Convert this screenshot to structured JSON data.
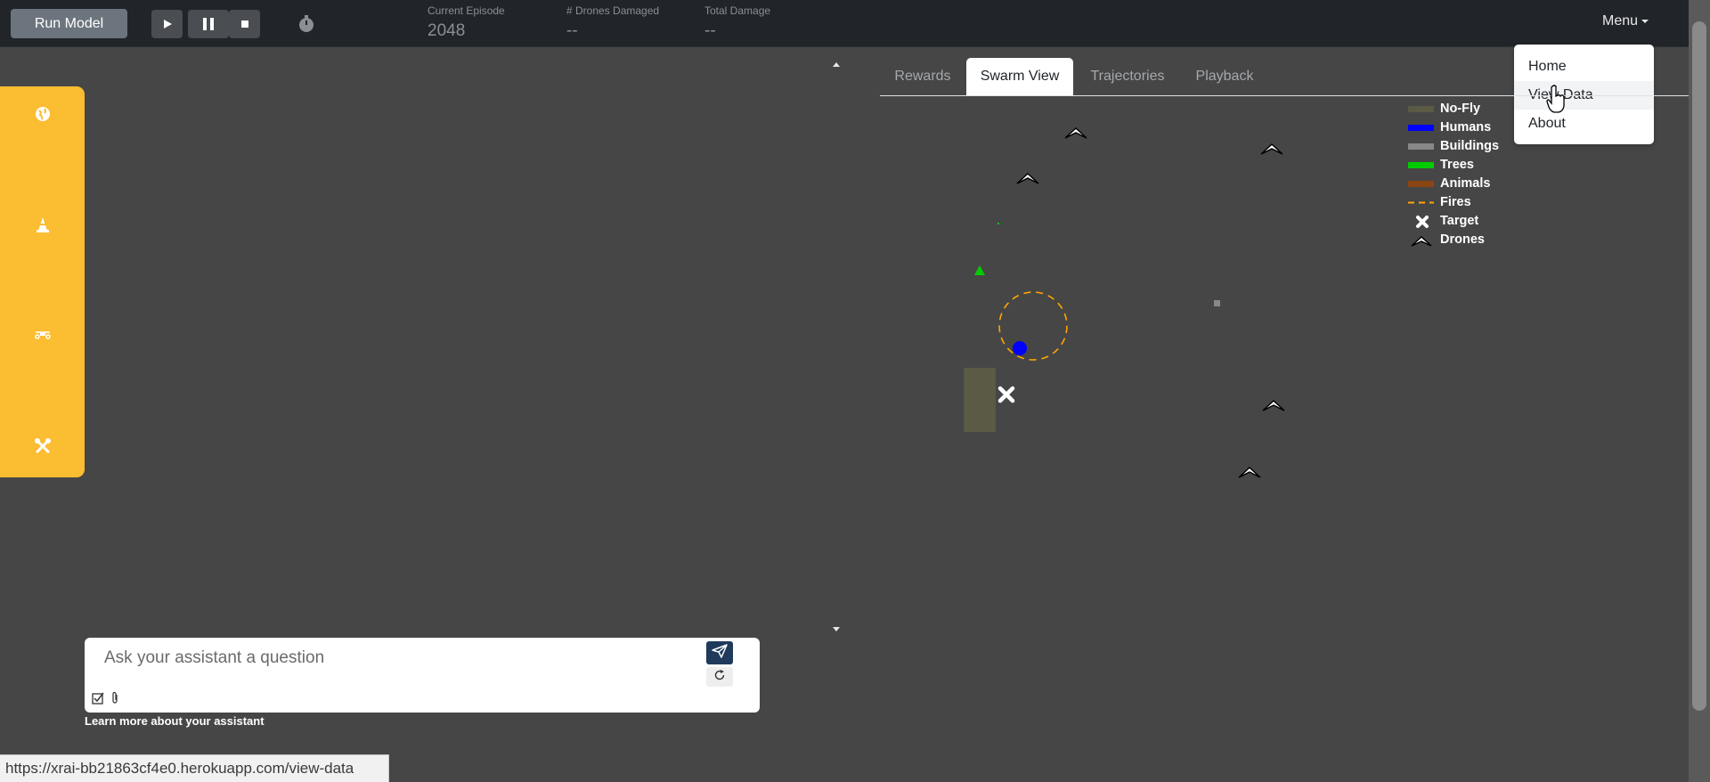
{
  "header": {
    "run_label": "Run Model",
    "stats": [
      {
        "label": "Current Episode",
        "value": "2048"
      },
      {
        "label": "# Drones Damaged",
        "value": "--"
      },
      {
        "label": "Total Damage",
        "value": "--"
      }
    ],
    "menu_label": "Menu",
    "icons": [
      "play-icon",
      "pause-icon",
      "stop-icon",
      "stopwatch-icon"
    ]
  },
  "menu_dropdown": {
    "items": [
      "Home",
      "View Data",
      "About"
    ],
    "hovered": "View Data"
  },
  "sidebar": {
    "background": "#fbbd31",
    "icons": [
      "globe-icon",
      "traffic-cone-icon",
      "drone-icon",
      "tools-icon"
    ]
  },
  "assistant": {
    "placeholder": "Ask your assistant a question",
    "learn_more": "Learn more about your assistant"
  },
  "tabs": {
    "items": [
      "Rewards",
      "Swarm View",
      "Trajectories",
      "Playback"
    ],
    "active": "Swarm View"
  },
  "legend": {
    "items": [
      {
        "label": "No-Fly",
        "color": "#5a5a45"
      },
      {
        "label": "Humans",
        "color": "#0000ff"
      },
      {
        "label": "Buildings",
        "color": "#888888"
      },
      {
        "label": "Trees",
        "color": "#00cc00"
      },
      {
        "label": "Animals",
        "color": "#8b4513"
      },
      {
        "label": "Fires",
        "color": "#ffa500"
      },
      {
        "label": "Target",
        "color": "#ffffff"
      },
      {
        "label": "Drones",
        "color": "#ffffff"
      }
    ]
  },
  "status_bar": {
    "url": "https://xrai-bb21863cf4e0.herokuapp.com/view-data"
  }
}
